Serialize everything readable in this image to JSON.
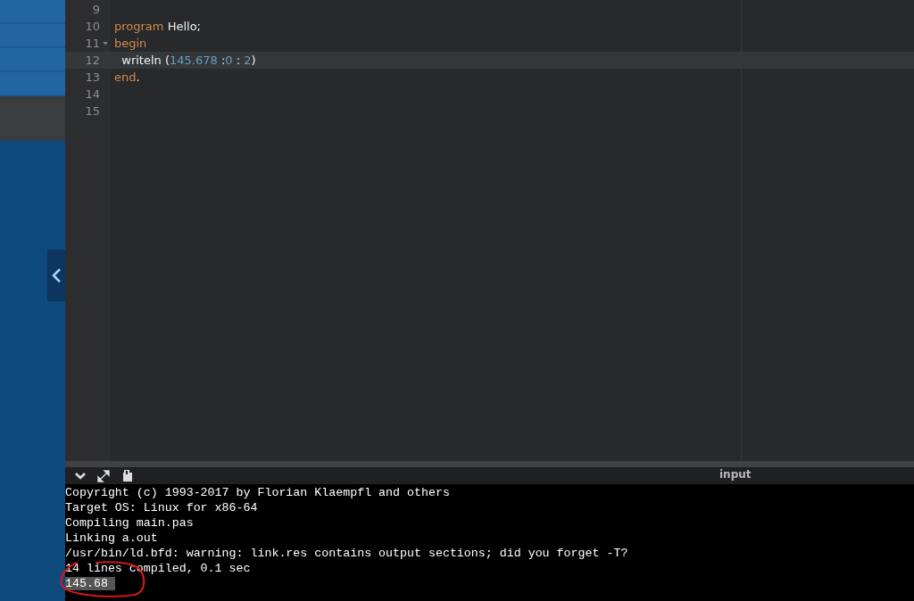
{
  "sidebar": {
    "items": [
      {
        "selected": false
      },
      {
        "selected": false
      },
      {
        "selected": false
      },
      {
        "selected": false
      },
      {
        "selected": true
      }
    ]
  },
  "editor": {
    "lines": [
      {
        "number": "9",
        "active": false,
        "foldable": false
      },
      {
        "number": "10",
        "active": false,
        "foldable": false,
        "tokens": [
          {
            "kind": "keyword",
            "text": "program"
          },
          {
            "kind": "plain",
            "text": " Hello;"
          }
        ]
      },
      {
        "number": "11",
        "active": false,
        "foldable": true,
        "tokens": [
          {
            "kind": "keyword",
            "text": "begin"
          }
        ]
      },
      {
        "number": "12",
        "active": true,
        "foldable": false,
        "tokens": [
          {
            "kind": "plain",
            "text": "  writeln ("
          },
          {
            "kind": "number",
            "text": "145.678"
          },
          {
            "kind": "plain",
            "text": " :"
          },
          {
            "kind": "number",
            "text": "0"
          },
          {
            "kind": "plain",
            "text": " : "
          },
          {
            "kind": "number",
            "text": "2"
          },
          {
            "kind": "plain",
            "text": ")"
          }
        ]
      },
      {
        "number": "13",
        "active": false,
        "foldable": false,
        "tokens": [
          {
            "kind": "keyword",
            "text": "end"
          },
          {
            "kind": "plain",
            "text": "."
          }
        ]
      },
      {
        "number": "14",
        "active": false,
        "foldable": false
      },
      {
        "number": "15",
        "active": false,
        "foldable": false
      }
    ]
  },
  "console": {
    "input_label": "input",
    "lines": [
      {
        "text": "Copyright (c) 1993-2017 by Florian Klaempfl and others",
        "selected": false
      },
      {
        "text": "Target OS: Linux for x86-64",
        "selected": false
      },
      {
        "text": "Compiling main.pas",
        "selected": false
      },
      {
        "text": "Linking a.out",
        "selected": false
      },
      {
        "text": "/usr/bin/ld.bfd: warning: link.res contains output sections; did you forget -T?",
        "selected": false
      },
      {
        "text": "14 lines compiled, 0.1 sec",
        "selected": false
      },
      {
        "text": "145.68 ",
        "selected": true
      }
    ]
  }
}
